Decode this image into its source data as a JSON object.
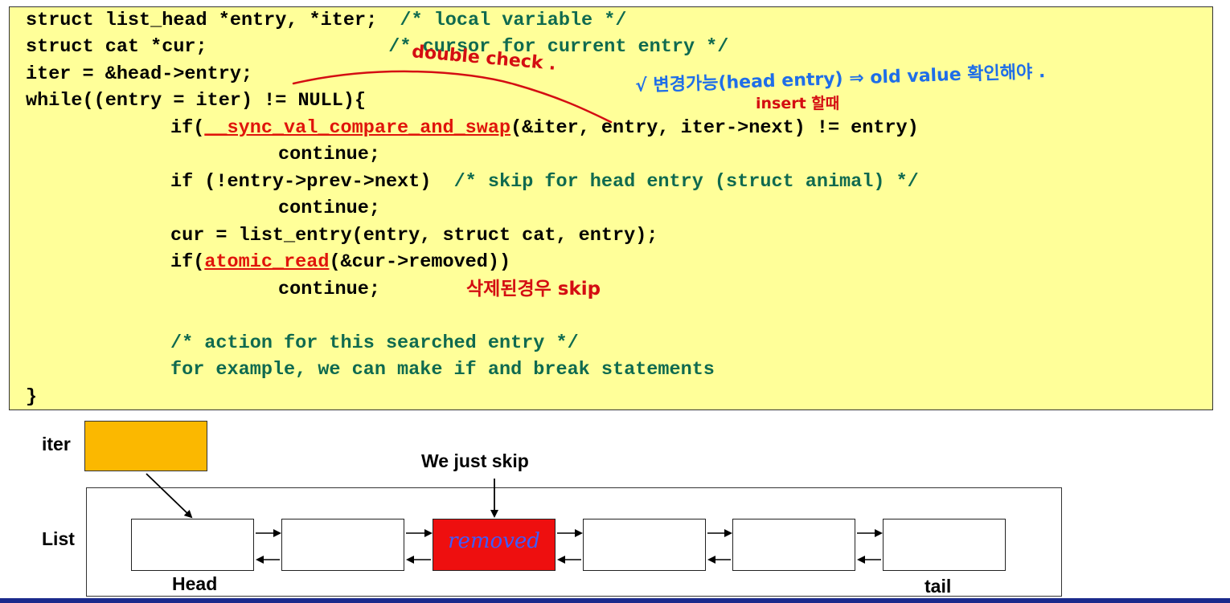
{
  "code": {
    "l1": "struct list_head *entry, *iter;",
    "l1_comment": "/* local variable */",
    "l2": "struct cat *cur;",
    "l2_comment": "/* cursor for current entry */",
    "l3": "iter = &head->entry;",
    "l4": "while((entry = iter) != NULL){",
    "l5_pre": "if(",
    "l5_fn": "__sync_val_compare_and_swap",
    "l5_post": "(&iter, entry, iter->next) != entry)",
    "l6": "continue;",
    "l7": "if (!entry->prev->next)",
    "l7_comment": "/* skip for head entry (struct animal) */",
    "l8": "continue;",
    "l9": "cur = list_entry(entry, struct cat, entry);",
    "l10_pre": "if(",
    "l10_fn": "atomic_read",
    "l10_post": "(&cur->removed))",
    "l11": "continue;",
    "l13_comment": "/* action for this searched entry */",
    "l14_comment": "for example, we can make if and break statements",
    "l15": "}"
  },
  "annotations": {
    "double_check": "double check .",
    "changeable": "√ 변경가능(head entry) ⇒ old value 확인해야 .",
    "insert": "insert 할때",
    "deleted_skip": "삭제된경우 skip"
  },
  "diagram": {
    "iter_label": "iter",
    "list_label": "List",
    "skip_label": "We just skip",
    "head_label": "Head",
    "tail_label": "tail",
    "removed_label": "removed"
  },
  "colors": {
    "code_bg": "#ffff99",
    "comment": "#0f6a4f",
    "function": "#e0140b",
    "iter_box": "#fbb800",
    "removed_node": "#ee0f0f",
    "annotation_red": "#d40d12",
    "annotation_blue": "#1f6ee8"
  }
}
